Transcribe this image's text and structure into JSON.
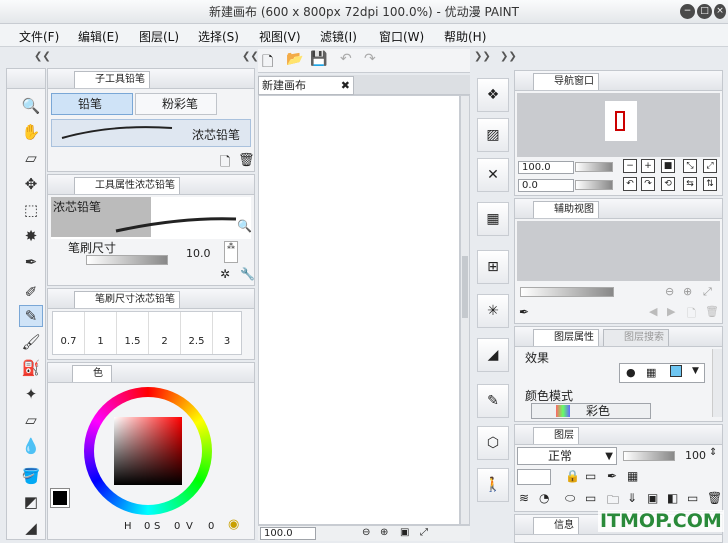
{
  "window": {
    "title": "新建画布 (600 x 800px 72dpi 100.0%) - 优动漫 PAINT"
  },
  "menu": [
    "文件(F)",
    "编辑(E)",
    "图层(L)",
    "选择(S)",
    "视图(V)",
    "滤镜(I)",
    "窗口(W)",
    "帮助(H)"
  ],
  "sub_tool": {
    "tab": "子工具铅笔",
    "items": [
      "铅笔",
      "粉彩笔"
    ],
    "preset": "浓芯铅笔"
  },
  "tool_property": {
    "tab": "工具属性浓芯铅笔",
    "preset": "浓芯铅笔",
    "brush_size_label": "笔刷尺寸",
    "brush_size_value": "10.0"
  },
  "brush_size": {
    "tab": "笔刷尺寸浓芯铅笔",
    "sizes": [
      "0.7",
      "1",
      "1.5",
      "2",
      "2.5",
      "3"
    ]
  },
  "color": {
    "tab": "色相环",
    "h_label": "H",
    "h": "0",
    "s_label": "S",
    "s": "0",
    "v_label": "V",
    "v": "0"
  },
  "canvas": {
    "tab": "新建画布",
    "zoom": "100.0"
  },
  "navigator": {
    "tab": "导航窗口",
    "zoom": "100.0",
    "angle": "0.0"
  },
  "sub_view": {
    "tab": "辅助视图"
  },
  "layer_property": {
    "tab": "图层属性",
    "tab2": "图层搜索",
    "effect_label": "效果",
    "color_mode_label": "颜色模式",
    "color_mode_value": "彩色"
  },
  "layer": {
    "tab": "图层",
    "blend": "正常",
    "opacity": "100"
  },
  "info": {
    "tab": "信息"
  },
  "watermark": "ITMOP.COM"
}
